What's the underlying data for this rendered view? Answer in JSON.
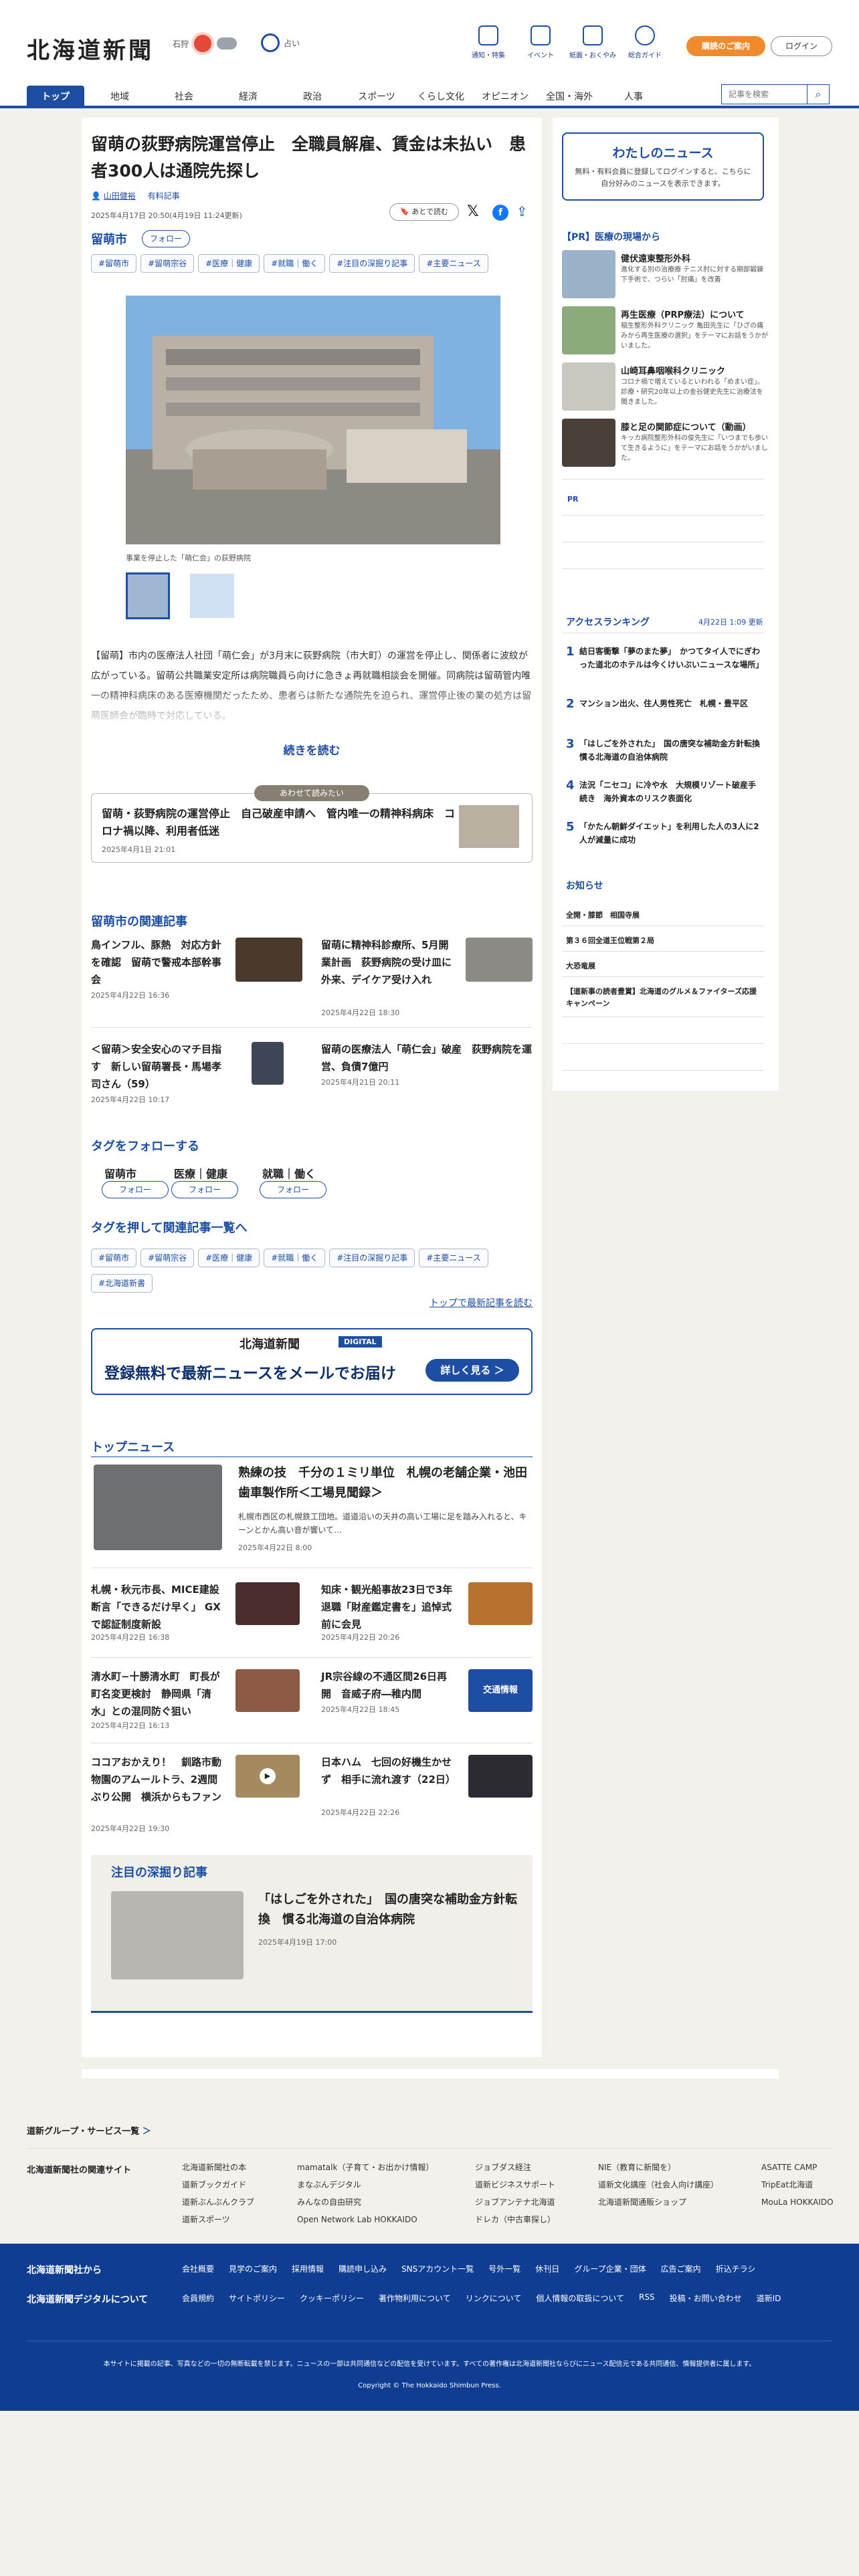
{
  "header": {
    "logo": "北海道新聞",
    "weather": {
      "city": "石狩",
      "label": "占い"
    },
    "icons": [
      "通知・特集",
      "イベント",
      "紙面・おくやみ",
      "総合ガイド"
    ],
    "subscribe": "購読のご案内",
    "login": "ログイン",
    "search_placeholder": "記事を検索"
  },
  "nav": [
    "トップ",
    "地域",
    "社会",
    "経済",
    "政治",
    "スポーツ",
    "くらし文化",
    "オピニオン",
    "全国・海外",
    "人事"
  ],
  "article": {
    "title": "留萌の荻野病院運営停止　全職員解雇、賃金は未払い　患者300人は通院先探し",
    "author": "山田健裕",
    "author_tag": "有料記事",
    "dates": "2025年4月17日 20:50(4月19日 11:24更新)",
    "save": "あとで読む",
    "location": "留萌市",
    "follow": "フォロー",
    "tags": [
      "#留萌市",
      "#留萌宗谷",
      "#医療｜健康",
      "#就職｜働く",
      "#注目の深掘り記事",
      "#主要ニュース"
    ],
    "caption": "事業を停止した「萌仁会」の荻野病院",
    "body": "【留萌】市内の医療法人社団「萌仁会」が3月末に荻野病院（市大町）の運営を停止し、関係者に波紋が広がっている。留萌公共職業安定所は病院職員ら向けに急きょ再就職相談会を開催。同病院は留萌管内唯一の精神科病床のある医療機関だったため、患者らは新たな通院先を迫られ、運営停止後の業の処方は留萌医師会が臨時で対応している。",
    "read_more": "続きを読む",
    "related_badge": "あわせて読みたい",
    "related": {
      "title": "留萌・荻野病院の運営停止　自己破産申請へ　管内唯一の精神科病床　コロナ禍以降、利用者低迷",
      "date": "2025年4月1日 21:01"
    }
  },
  "local_news": {
    "title": "留萌市の関連記事",
    "items": [
      {
        "title": "鳥インフル、豚熱　対応方針を確認　留萌で警戒本部幹事会",
        "date": "2025年4月22日 16:36"
      },
      {
        "title": "留萌に精神科診療所、5月開業計画　荻野病院の受け皿に　外来、デイケア受け入れ",
        "date": "2025年4月22日 18:30"
      },
      {
        "title": "＜留萌＞安全安心のマチ目指す　新しい留萌署長・馬場孝司さん（59）",
        "date": "2025年4月22日 10:17"
      },
      {
        "title": "留萌の医療法人「萌仁会」破産　荻野病院を運営、負債7億円",
        "date": "2025年4月21日 20:11"
      }
    ]
  },
  "follow_tags": {
    "title": "タグをフォローする",
    "items": [
      {
        "name": "留萌市",
        "btn": "フォロー"
      },
      {
        "name": "医療｜健康",
        "btn": "フォロー"
      },
      {
        "name": "就職｜働く",
        "btn": "フォロー"
      }
    ]
  },
  "tag_list": {
    "title": "タグを押して関連記事一覧へ",
    "items": [
      "#留萌市",
      "#留萌宗谷",
      "#医療｜健康",
      "#就職｜働く",
      "#注目の深掘り記事",
      "#主要ニュース",
      "#北海道新書"
    ],
    "more": "トップで最新記事を読む"
  },
  "banner": {
    "brand": "北海道新聞",
    "tag": "DIGITAL",
    "text": "登録無料で最新ニュースをメールでお届け",
    "btn": "詳しく見る ＞"
  },
  "top_news": {
    "title": "トップニュース",
    "lead": {
      "title": "熟練の技　千分の１ミリ単位　札幌の老舗企業・池田歯車製作所＜工場見聞録＞",
      "desc": "札幌市西区の札幌鉄工団地。道道沿いの天井の高い工場に足を踏み入れると、キーンとかん高い音が響いて…",
      "date": "2025年4月22日 8:00"
    },
    "items": [
      {
        "title": "札幌・秋元市長、MICE建設断言「できるだけ早く」 GXで認証制度新設",
        "date": "2025年4月22日 16:38"
      },
      {
        "title": "知床・観光船事故23日で3年　退職「財産鑑定書を」追悼式前に会見",
        "date": "2025年4月22日 20:26"
      },
      {
        "title": "清水町−十勝清水町　町長が町名変更検討　静岡県「清水」との混同防ぐ狙い",
        "date": "2025年4月22日 16:13"
      },
      {
        "title": "JR宗谷線の不通区間26日再開　音威子府―稚内間",
        "date": "2025年4月22日 18:45"
      },
      {
        "title": "ココアおかえり！　釧路市動物園のアムールトラ、2週間ぶり公開　横浜からもファン",
        "date": "2025年4月22日 19:30"
      },
      {
        "title": "日本ハム　七回の好機生かせず　相手に流れ渡す（22日）",
        "date": "2025年4月22日 22:26"
      }
    ]
  },
  "deep": {
    "title": "注目の深掘り記事",
    "item": {
      "title": "「はしごを外された」　国の唐突な補助金方針転換　慣る北海道の自治体病院",
      "date": "2025年4月19日 17:00"
    }
  },
  "side": {
    "my_news": {
      "title": "わたしのニュース",
      "desc": "無料・有料会員に登録してログインすると、こちらに自分好みのニュースを表示できます。"
    },
    "pr_title": "【PR】医療の現場から",
    "pr": [
      {
        "title": "健伏遠東整形外科",
        "desc": "進化する別の治療療 テニス肘に対する期部鍛錬下手術で、つらい「肘痛」を改善"
      },
      {
        "title": "再生医療（PRP療法）について",
        "desc": "稲生整形外科クリニック 亀田先生に「ひざの痛みから再生医療の選択」をテーマにお話をうかがいました。"
      },
      {
        "title": "山崎耳鼻咽喉科クリニック",
        "desc": "コロナ禍で増えているといわれる「めまい症」。診療・研究20年以上の金谷健史先生に治療法を聞きました。"
      },
      {
        "title": "膝と足の関節症について（動画）",
        "desc": "キッカ病院整形外科の俊先生に「いつまでも歩いて生きるように」をテーマにお話をうかがいました。"
      }
    ],
    "pr2": "PR",
    "ranking_title": "アクセスランキング",
    "ranking_time": "4月22日 1:09 更新",
    "ranking": [
      "結日客衝撃「夢のまた夢」　かつてタイ人でにぎわった道北のホテルは今くけいぶいニュースな場所」",
      "マンション出火、住人男性死亡　札幌・豊平区",
      "「はしごを外された」　国の唐突な補助金方針転換　慣る北海道の自治体病院",
      "法況「ニセコ」に冷や水　大規模リゾート破産手続き　海外資本のリスク表面化",
      "「かたん朝鮮ダイエット」を利用した人の3人に2人が減量に成功"
    ],
    "notice_title": "お知らせ",
    "notices": [
      "全開・膝節　相国寺展",
      "第３６回全道王位戦第２局",
      "大恐竜展",
      "【道新事の読者豊賞】北海道のグルメ＆ファイターズ応援キャンペーン"
    ]
  },
  "footer": {
    "group": "道新グループ・サービス一覧",
    "related": "北海道新聞社の関連サイト",
    "cols": [
      [
        "北海道新聞社の本",
        "道新ブックガイド",
        "道新ぶんぶんクラブ",
        "道新スポーツ"
      ],
      [
        "mamatalk（子育て・お出かけ情報）",
        "まなぶんデジタル",
        "みんなの自由研究",
        "Open Network Lab HOKKAIDO"
      ],
      [
        "ジョブダス経注",
        "道新ビジネスサポート",
        "ジョブアンテナ北海道",
        "ドレカ（中古車探し）"
      ],
      [
        "NIE（教育に新聞を）",
        "道新文化講座（社会人向け講座）",
        "北海道新聞通販ショップ"
      ],
      [
        "ASATTE CAMP",
        "TripEat北海道",
        "MouLa HOKKAIDO"
      ]
    ],
    "from": "北海道新聞社から",
    "about": "北海道新聞デジタルについて",
    "links1": [
      "会社概要",
      "見学のご案内",
      "採用情報",
      "購読申し込み",
      "SNSアカウント一覧",
      "号外一覧",
      "休刊日",
      "グループ企業・団体",
      "広告ご案内",
      "折込チラシ"
    ],
    "links2": [
      "会員規約",
      "サイトポリシー",
      "クッキーポリシー",
      "著作物利用について",
      "リンクについて",
      "個人情報の取扱について",
      "RSS",
      "投稿・お問い合わせ",
      "道新ID"
    ],
    "notice": "本サイトに掲載の記事、写真などの一切の無断転載を禁じます。ニュースの一部は共同通信などの配信を受けています。すべての著作権は北海道新聞社ならびにニュース配信元である共同通信、情報提供者に属します。",
    "copyright": "Copyright © The Hokkaido Shimbun Press."
  }
}
